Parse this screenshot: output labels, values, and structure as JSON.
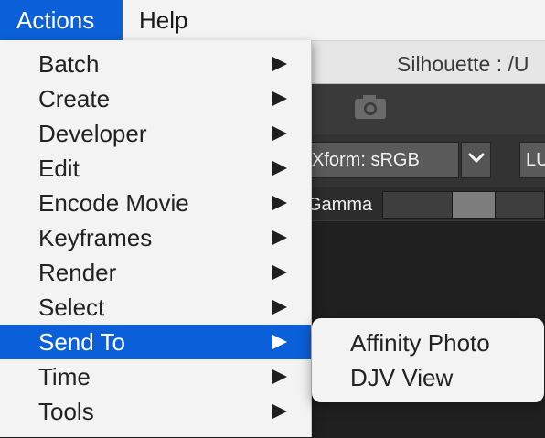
{
  "menubar": {
    "items": [
      {
        "label": "Actions",
        "active": true
      },
      {
        "label": "Help",
        "active": false
      }
    ]
  },
  "window": {
    "title": "Silhouette : /U",
    "icons": {
      "camera": "camera-icon"
    },
    "xform": {
      "value": "Xform: sRGB"
    },
    "lut": {
      "value": "LU"
    },
    "gamma": {
      "label": "Gamma"
    }
  },
  "actions_menu": {
    "items": [
      {
        "label": "Batch",
        "has_submenu": true
      },
      {
        "label": "Create",
        "has_submenu": true
      },
      {
        "label": "Developer",
        "has_submenu": true
      },
      {
        "label": "Edit",
        "has_submenu": true
      },
      {
        "label": "Encode Movie",
        "has_submenu": true
      },
      {
        "label": "Keyframes",
        "has_submenu": true
      },
      {
        "label": "Render",
        "has_submenu": true
      },
      {
        "label": "Select",
        "has_submenu": true
      },
      {
        "label": "Send To",
        "has_submenu": true,
        "selected": true
      },
      {
        "label": "Time",
        "has_submenu": true
      },
      {
        "label": "Tools",
        "has_submenu": true
      }
    ]
  },
  "send_to_submenu": {
    "items": [
      {
        "label": "Affinity Photo"
      },
      {
        "label": "DJV View"
      }
    ]
  },
  "colors": {
    "accent": "#0b5fd8",
    "menu_bg": "#f3f3f3"
  }
}
